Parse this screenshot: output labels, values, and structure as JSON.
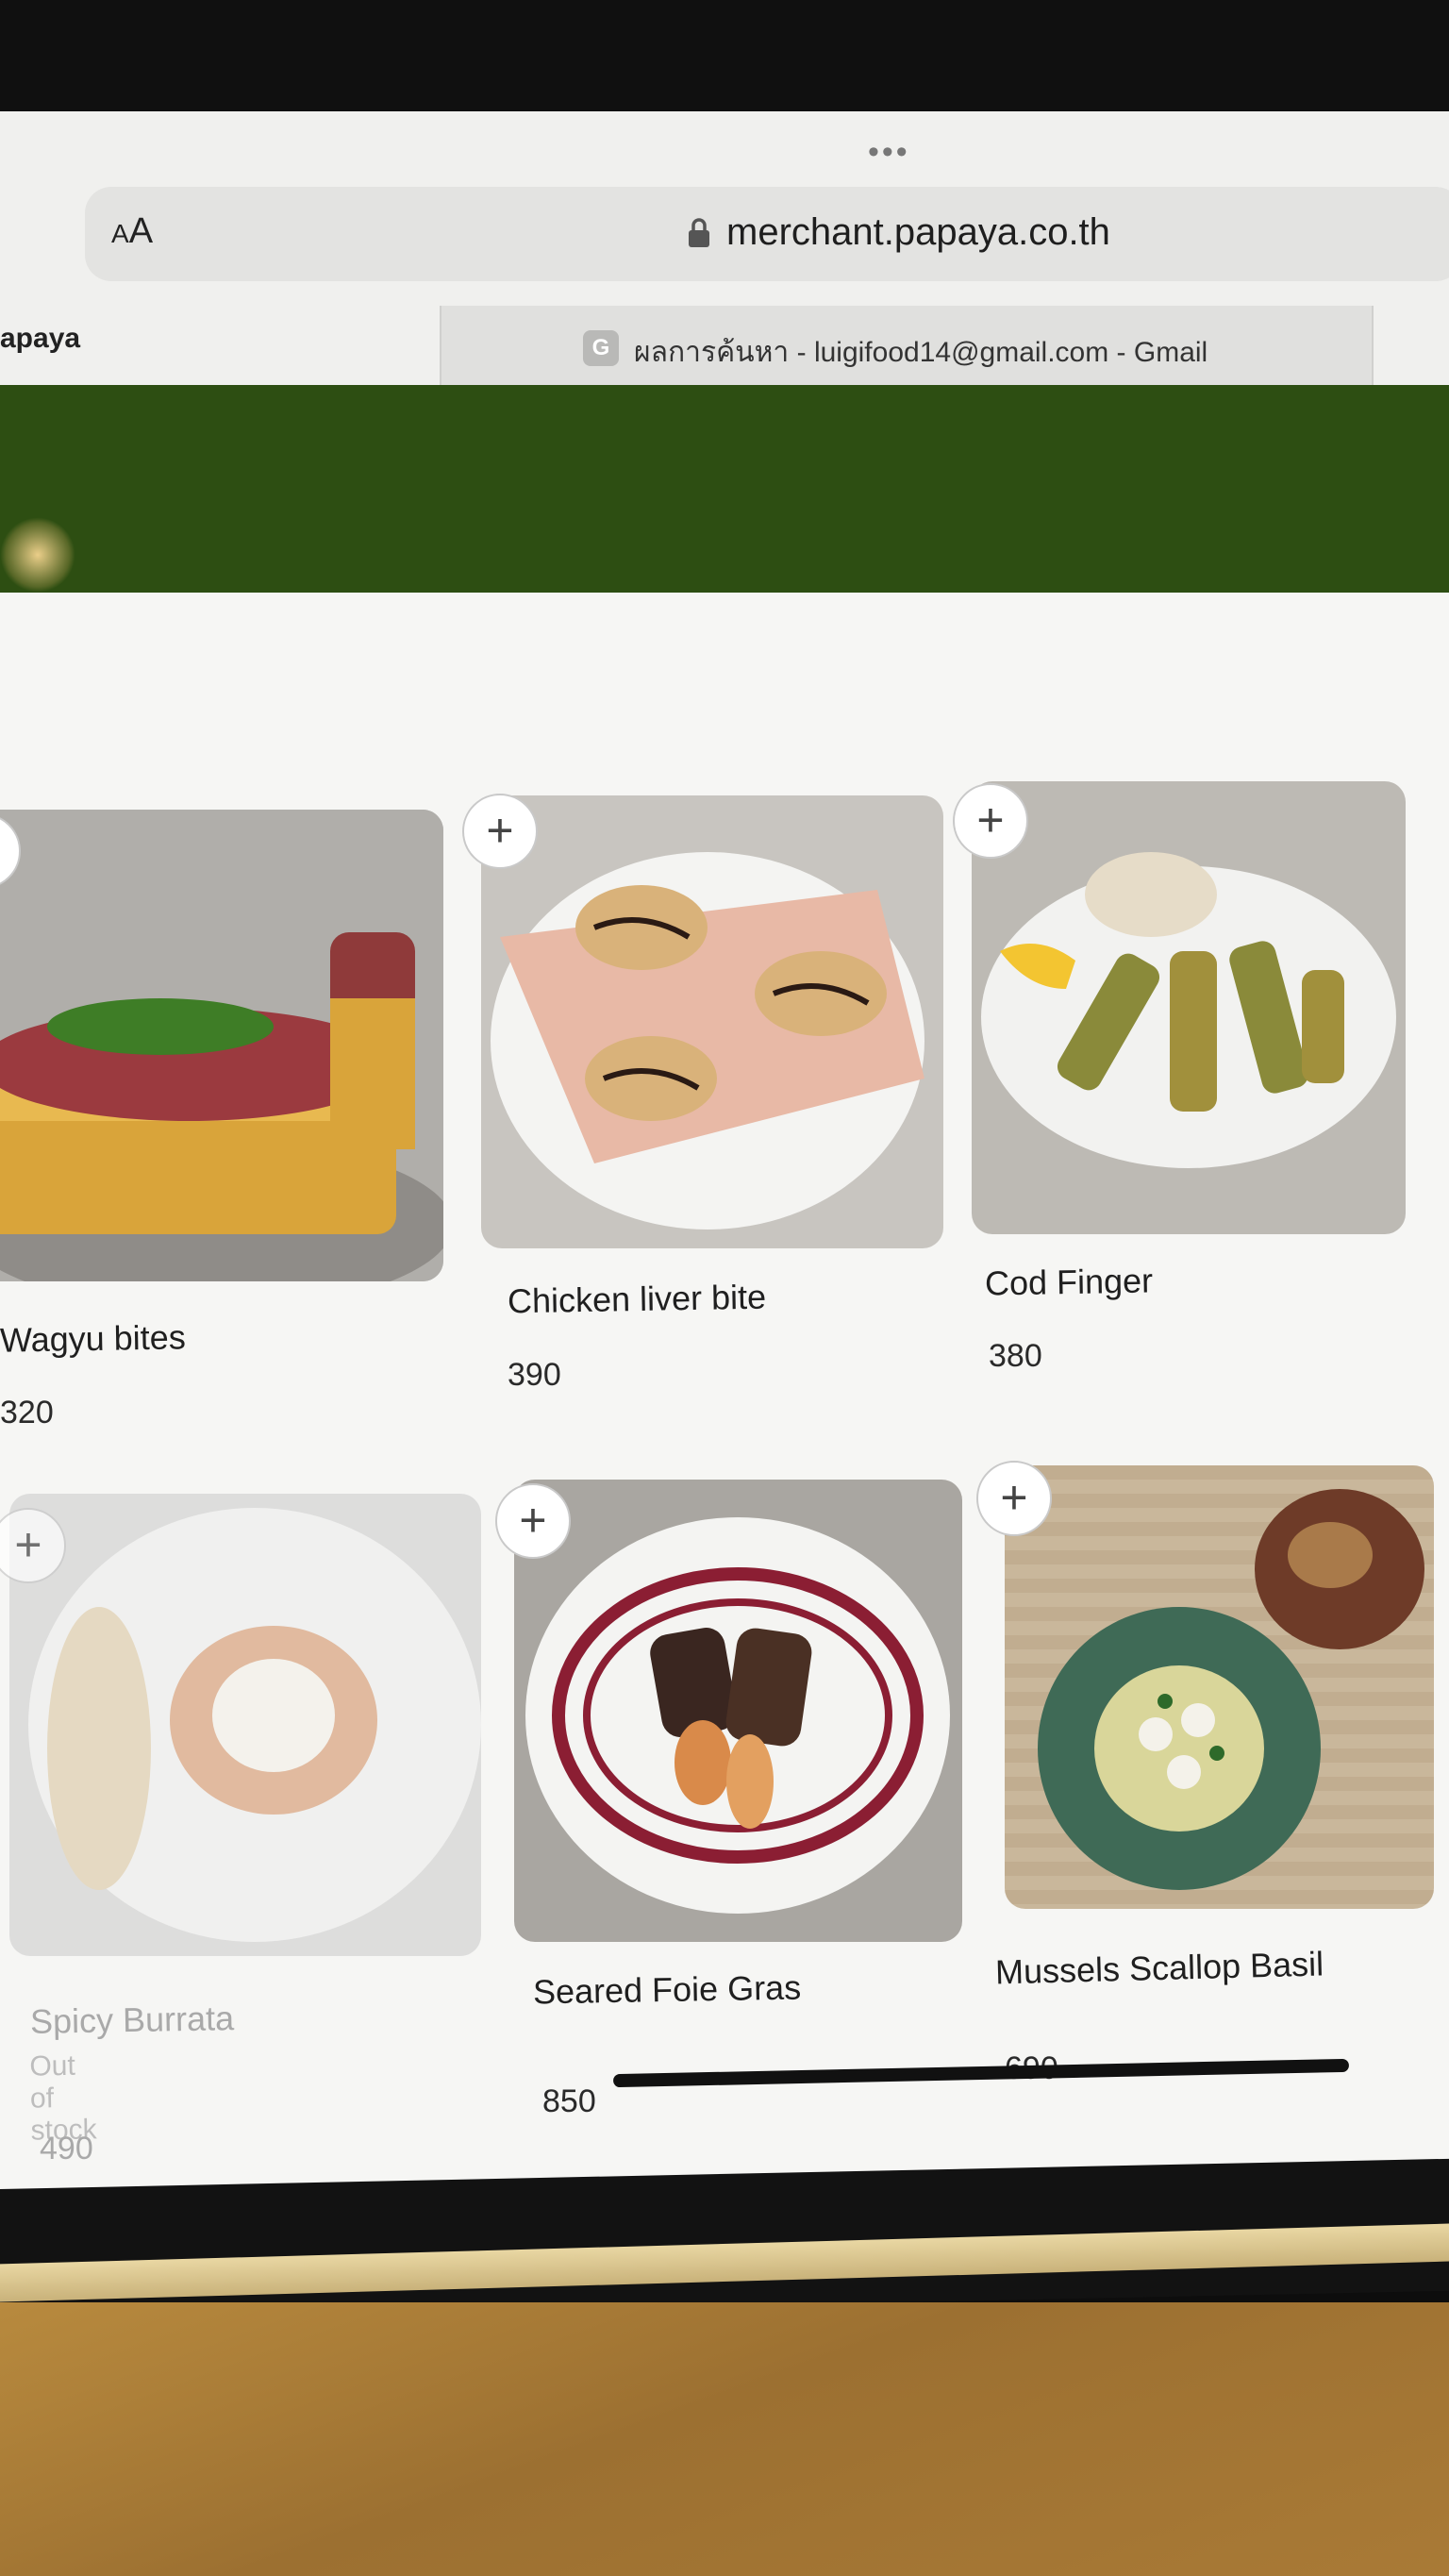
{
  "browser": {
    "more_dots": "•••",
    "aa_small": "A",
    "aa_large": "A",
    "url": "merchant.papaya.co.th",
    "tabs": [
      {
        "label": "apaya"
      },
      {
        "icon_letter": "G",
        "label": "ผลการค้นหา - luigifood14@gmail.com - Gmail"
      }
    ]
  },
  "colors": {
    "header_green": "#2d4e12",
    "page_bg": "#f6f6f4"
  },
  "menu": {
    "add_symbol": "+",
    "items": [
      {
        "name": "Wagyu bites",
        "price": "320",
        "status": ""
      },
      {
        "name": "Chicken liver bite",
        "price": "390",
        "status": ""
      },
      {
        "name": "Cod Finger",
        "price": "380",
        "status": ""
      },
      {
        "name": "Spicy Burrata",
        "price": "490",
        "status": "Out of stock"
      },
      {
        "name": "Seared Foie Gras",
        "price": "850",
        "status": ""
      },
      {
        "name": "Mussels Scallop Basil",
        "price": "690",
        "status": ""
      }
    ]
  }
}
